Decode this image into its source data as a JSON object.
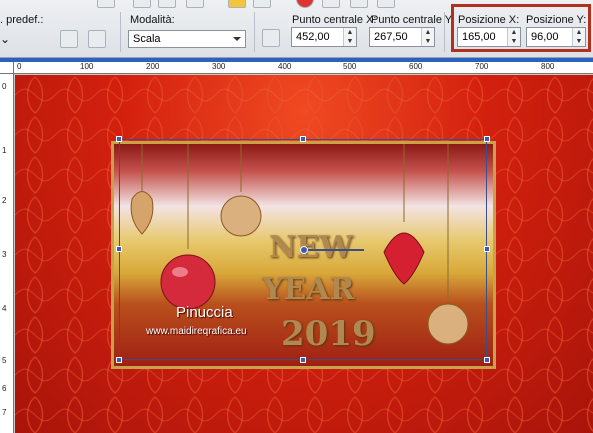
{
  "toolbar": {
    "preset_label": ". predef.:",
    "mode_label": "Modalità:",
    "mode_value": "Scala",
    "center_x_label": "Punto centrale X:",
    "center_x_value": "452,00",
    "center_y_label": "Punto centrale Y:",
    "center_y_value": "267,50",
    "pos_x_label": "Posizione X:",
    "pos_x_value": "165,00",
    "pos_y_label": "Posizione Y:",
    "pos_y_value": "96,00"
  },
  "ruler_h": [
    "0",
    "100",
    "200",
    "300",
    "400",
    "500",
    "600",
    "700",
    "800"
  ],
  "ruler_v": [
    "0",
    "1",
    "2",
    "3",
    "4",
    "5",
    "6",
    "7"
  ],
  "canvas": {
    "word_new": "NEW",
    "word_year": "YEAR",
    "word_2019": "2019",
    "signature_name": "Pinuccia",
    "signature_url": "www.maidireqrafica.eu"
  },
  "colors": {
    "background_red": "#d3200e",
    "highlight": "#b1301f",
    "gold": "#c8a24a"
  }
}
